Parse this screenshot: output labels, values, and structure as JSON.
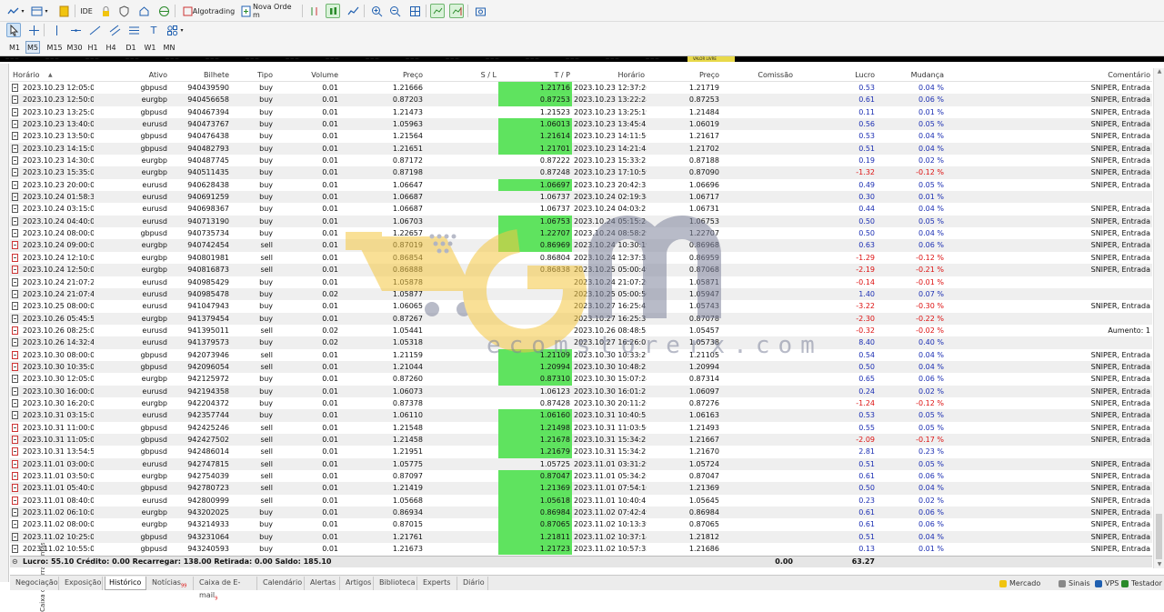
{
  "toolbar": {
    "algotrading_label": "Algotrading",
    "new_order_label": "Nova Orde m",
    "ide_label": "IDE"
  },
  "timeframes": [
    "M1",
    "M5",
    "M15",
    "M30",
    "H1",
    "H4",
    "D1",
    "W1",
    "MN"
  ],
  "active_timeframe": "M5",
  "columns": {
    "time": "Horário",
    "symbol": "Ativo",
    "ticket": "Bilhete",
    "type": "Tipo",
    "volume": "Volume",
    "price": "Preço",
    "sl": "S / L",
    "tp": "T / P",
    "close_time": "Horário",
    "close_price": "Preço",
    "commission": "Comissão",
    "profit": "Lucro",
    "change": "Mudança",
    "comment": "Comentário"
  },
  "rows": [
    {
      "t": "2023.10.23 12:05:03",
      "s": "gbpusd",
      "b": "940439590",
      "ty": "buy",
      "v": "0.01",
      "p": "1.21666",
      "tp": "1.21716",
      "ct": "2023.10.23 12:37:20",
      "cp": "1.21719",
      "pr": "0.53",
      "ch": "0.04 %",
      "cm": "SNIPER, Entrada"
    },
    {
      "t": "2023.10.23 12:50:02",
      "s": "eurgbp",
      "b": "940456658",
      "ty": "buy",
      "v": "0.01",
      "p": "0.87203",
      "tp": "0.87253",
      "ct": "2023.10.23 13:22:28",
      "cp": "0.87253",
      "pr": "0.61",
      "ch": "0.06 %",
      "cm": "SNIPER, Entrada"
    },
    {
      "t": "2023.10.23 13:25:02",
      "s": "gbpusd",
      "b": "940467394",
      "ty": "buy",
      "v": "0.01",
      "p": "1.21473",
      "tp": "1.21523",
      "ct": "2023.10.23 13:25:19",
      "cp": "1.21484",
      "pr": "0.11",
      "ch": "0.01 %",
      "cm": "SNIPER, Entrada"
    },
    {
      "t": "2023.10.23 13:40:03",
      "s": "eurusd",
      "b": "940473767",
      "ty": "buy",
      "v": "0.01",
      "p": "1.05963",
      "tp": "1.06013",
      "ct": "2023.10.23 13:45:43",
      "cp": "1.06019",
      "pr": "0.56",
      "ch": "0.05 %",
      "cm": "SNIPER, Entrada"
    },
    {
      "t": "2023.10.23 13:50:04",
      "s": "gbpusd",
      "b": "940476438",
      "ty": "buy",
      "v": "0.01",
      "p": "1.21564",
      "tp": "1.21614",
      "ct": "2023.10.23 14:11:56",
      "cp": "1.21617",
      "pr": "0.53",
      "ch": "0.04 %",
      "cm": "SNIPER, Entrada"
    },
    {
      "t": "2023.10.23 14:15:02",
      "s": "gbpusd",
      "b": "940482793",
      "ty": "buy",
      "v": "0.01",
      "p": "1.21651",
      "tp": "1.21701",
      "ct": "2023.10.23 14:21:48",
      "cp": "1.21702",
      "pr": "0.51",
      "ch": "0.04 %",
      "cm": "SNIPER, Entrada"
    },
    {
      "t": "2023.10.23 14:30:03",
      "s": "eurgbp",
      "b": "940487745",
      "ty": "buy",
      "v": "0.01",
      "p": "0.87172",
      "tp": "0.87222",
      "ct": "2023.10.23 15:33:23",
      "cp": "0.87188",
      "pr": "0.19",
      "ch": "0.02 %",
      "cm": "SNIPER, Entrada"
    },
    {
      "t": "2023.10.23 15:35:02",
      "s": "eurgbp",
      "b": "940511435",
      "ty": "buy",
      "v": "0.01",
      "p": "0.87198",
      "tp": "0.87248",
      "ct": "2023.10.23 17:10:59",
      "cp": "0.87090",
      "pr": "-1.32",
      "ch": "-0.12 %",
      "cm": "SNIPER, Entrada"
    },
    {
      "t": "2023.10.23 20:00:02",
      "s": "eurusd",
      "b": "940628438",
      "ty": "buy",
      "v": "0.01",
      "p": "1.06647",
      "tp": "1.06697",
      "ct": "2023.10.23 20:42:33",
      "cp": "1.06696",
      "pr": "0.49",
      "ch": "0.05 %",
      "cm": "SNIPER, Entrada"
    },
    {
      "t": "2023.10.24 01:58:36",
      "s": "eurusd",
      "b": "940691259",
      "ty": "buy",
      "v": "0.01",
      "p": "1.06687",
      "tp": "1.06737",
      "ct": "2023.10.24 02:19:34",
      "cp": "1.06717",
      "pr": "0.30",
      "ch": "0.01 %",
      "cm": ""
    },
    {
      "t": "2023.10.24 03:15:02",
      "s": "eurusd",
      "b": "940698367",
      "ty": "buy",
      "v": "0.01",
      "p": "1.06687",
      "tp": "1.06737",
      "ct": "2023.10.24 04:03:21",
      "cp": "1.06731",
      "pr": "0.44",
      "ch": "0.04 %",
      "cm": "SNIPER, Entrada"
    },
    {
      "t": "2023.10.24 04:40:03",
      "s": "eurusd",
      "b": "940713190",
      "ty": "buy",
      "v": "0.01",
      "p": "1.06703",
      "tp": "1.06753",
      "ct": "2023.10.24 05:15:28",
      "cp": "1.06753",
      "pr": "0.50",
      "ch": "0.05 %",
      "cm": "SNIPER, Entrada"
    },
    {
      "t": "2023.10.24 08:00:03",
      "s": "gbpusd",
      "b": "940735734",
      "ty": "buy",
      "v": "0.01",
      "p": "1.22657",
      "tp": "1.22707",
      "ct": "2023.10.24 08:58:29",
      "cp": "1.22707",
      "pr": "0.50",
      "ch": "0.04 %",
      "cm": "SNIPER, Entrada"
    },
    {
      "t": "2023.10.24 09:00:02",
      "s": "eurgbp",
      "b": "940742454",
      "ty": "sell",
      "v": "0.01",
      "p": "0.87019",
      "tp": "0.86969",
      "ct": "2023.10.24 10:30:19",
      "cp": "0.86968",
      "pr": "0.63",
      "ch": "0.06 %",
      "cm": "SNIPER, Entrada"
    },
    {
      "t": "2023.10.24 12:10:02",
      "s": "eurgbp",
      "b": "940801981",
      "ty": "sell",
      "v": "0.01",
      "p": "0.86854",
      "tp": "0.86804",
      "ct": "2023.10.24 12:37:35",
      "cp": "0.86959",
      "pr": "-1.29",
      "ch": "-0.12 %",
      "cm": "SNIPER, Entrada"
    },
    {
      "t": "2023.10.24 12:50:02",
      "s": "eurgbp",
      "b": "940816873",
      "ty": "sell",
      "v": "0.01",
      "p": "0.86888",
      "tp": "0.86838",
      "ct": "2023.10.25 05:00:49",
      "cp": "0.87068",
      "pr": "-2.19",
      "ch": "-0.21 %",
      "cm": "SNIPER, Entrada"
    },
    {
      "t": "2023.10.24 21:07:20",
      "s": "eurusd",
      "b": "940985429",
      "ty": "buy",
      "v": "0.01",
      "p": "1.05878",
      "tp": "",
      "ct": "2023.10.24 21:07:26",
      "cp": "1.05871",
      "pr": "-0.14",
      "ch": "-0.01 %",
      "cm": ""
    },
    {
      "t": "2023.10.24 21:07:41",
      "s": "eurusd",
      "b": "940985478",
      "ty": "buy",
      "v": "0.02",
      "p": "1.05877",
      "tp": "",
      "ct": "2023.10.25 05:00:50",
      "cp": "1.05947",
      "pr": "1.40",
      "ch": "0.07 %",
      "cm": ""
    },
    {
      "t": "2023.10.25 08:00:02",
      "s": "eurusd",
      "b": "941047943",
      "ty": "buy",
      "v": "0.01",
      "p": "1.06065",
      "tp": "",
      "ct": "2023.10.27 16:25:42",
      "cp": "1.05743",
      "pr": "-3.22",
      "ch": "-0.30 %",
      "cm": "SNIPER, Entrada"
    },
    {
      "t": "2023.10.26 05:45:57",
      "s": "eurgbp",
      "b": "941379454",
      "ty": "buy",
      "v": "0.01",
      "p": "0.87267",
      "tp": "",
      "ct": "2023.10.27 16:25:37",
      "cp": "0.87078",
      "pr": "-2.30",
      "ch": "-0.22 %",
      "cm": ""
    },
    {
      "t": "2023.10.26 08:25:04",
      "s": "eurusd",
      "b": "941395011",
      "ty": "sell",
      "v": "0.02",
      "p": "1.05441",
      "tp": "",
      "ct": "2023.10.26 08:48:55",
      "cp": "1.05457",
      "pr": "-0.32",
      "ch": "-0.02 %",
      "cm": "Aumento: 1"
    },
    {
      "t": "2023.10.26 14:32:43",
      "s": "eurusd",
      "b": "941379573",
      "ty": "buy",
      "v": "0.02",
      "p": "1.05318",
      "tp": "",
      "ct": "2023.10.27 16:26:02",
      "cp": "1.05738",
      "pr": "8.40",
      "ch": "0.40 %",
      "cm": ""
    },
    {
      "t": "2023.10.30 08:00:03",
      "s": "gbpusd",
      "b": "942073946",
      "ty": "sell",
      "v": "0.01",
      "p": "1.21159",
      "tp": "1.21109",
      "ct": "2023.10.30 10:33:29",
      "cp": "1.21105",
      "pr": "0.54",
      "ch": "0.04 %",
      "cm": "SNIPER, Entrada"
    },
    {
      "t": "2023.10.30 10:35:02",
      "s": "gbpusd",
      "b": "942096054",
      "ty": "sell",
      "v": "0.01",
      "p": "1.21044",
      "tp": "1.20994",
      "ct": "2023.10.30 10:48:23",
      "cp": "1.20994",
      "pr": "0.50",
      "ch": "0.04 %",
      "cm": "SNIPER, Entrada"
    },
    {
      "t": "2023.10.30 12:05:02",
      "s": "eurgbp",
      "b": "942125972",
      "ty": "buy",
      "v": "0.01",
      "p": "0.87260",
      "tp": "0.87310",
      "ct": "2023.10.30 15:07:24",
      "cp": "0.87314",
      "pr": "0.65",
      "ch": "0.06 %",
      "cm": "SNIPER, Entrada"
    },
    {
      "t": "2023.10.30 16:00:02",
      "s": "eurusd",
      "b": "942194358",
      "ty": "buy",
      "v": "0.01",
      "p": "1.06073",
      "tp": "1.06123",
      "ct": "2023.10.30 16:01:21",
      "cp": "1.06097",
      "pr": "0.24",
      "ch": "0.02 %",
      "cm": "SNIPER, Entrada"
    },
    {
      "t": "2023.10.30 16:20:02",
      "s": "eurgbp",
      "b": "942204372",
      "ty": "buy",
      "v": "0.01",
      "p": "0.87378",
      "tp": "0.87428",
      "ct": "2023.10.30 20:11:26",
      "cp": "0.87276",
      "pr": "-1.24",
      "ch": "-0.12 %",
      "cm": "SNIPER, Entrada"
    },
    {
      "t": "2023.10.31 03:15:02",
      "s": "eurusd",
      "b": "942357744",
      "ty": "buy",
      "v": "0.01",
      "p": "1.06110",
      "tp": "1.06160",
      "ct": "2023.10.31 10:40:55",
      "cp": "1.06163",
      "pr": "0.53",
      "ch": "0.05 %",
      "cm": "SNIPER, Entrada"
    },
    {
      "t": "2023.10.31 11:00:03",
      "s": "gbpusd",
      "b": "942425246",
      "ty": "sell",
      "v": "0.01",
      "p": "1.21548",
      "tp": "1.21498",
      "ct": "2023.10.31 11:03:50",
      "cp": "1.21493",
      "pr": "0.55",
      "ch": "0.05 %",
      "cm": "SNIPER, Entrada"
    },
    {
      "t": "2023.10.31 11:05:03",
      "s": "gbpusd",
      "b": "942427502",
      "ty": "sell",
      "v": "0.01",
      "p": "1.21458",
      "tp": "1.21678",
      "ct": "2023.10.31 15:34:21",
      "cp": "1.21667",
      "pr": "-2.09",
      "ch": "-0.17 %",
      "cm": "SNIPER, Entrada"
    },
    {
      "t": "2023.10.31 13:54:53",
      "s": "gbpusd",
      "b": "942486014",
      "ty": "sell",
      "v": "0.01",
      "p": "1.21951",
      "tp": "1.21679",
      "ct": "2023.10.31 15:34:21",
      "cp": "1.21670",
      "pr": "2.81",
      "ch": "0.23 %",
      "cm": ""
    },
    {
      "t": "2023.11.01 03:00:02",
      "s": "eurusd",
      "b": "942747815",
      "ty": "sell",
      "v": "0.01",
      "p": "1.05775",
      "tp": "1.05725",
      "ct": "2023.11.01 03:31:29",
      "cp": "1.05724",
      "pr": "0.51",
      "ch": "0.05 %",
      "cm": "SNIPER, Entrada"
    },
    {
      "t": "2023.11.01 03:50:02",
      "s": "eurgbp",
      "b": "942754039",
      "ty": "sell",
      "v": "0.01",
      "p": "0.87097",
      "tp": "0.87047",
      "ct": "2023.11.01 05:34:26",
      "cp": "0.87047",
      "pr": "0.61",
      "ch": "0.06 %",
      "cm": "SNIPER, Entrada"
    },
    {
      "t": "2023.11.01 05:40:03",
      "s": "gbpusd",
      "b": "942780723",
      "ty": "sell",
      "v": "0.01",
      "p": "1.21419",
      "tp": "1.21369",
      "ct": "2023.11.01 07:54:10",
      "cp": "1.21369",
      "pr": "0.50",
      "ch": "0.04 %",
      "cm": "SNIPER, Entrada"
    },
    {
      "t": "2023.11.01 08:40:02",
      "s": "eurusd",
      "b": "942800999",
      "ty": "sell",
      "v": "0.01",
      "p": "1.05668",
      "tp": "1.05618",
      "ct": "2023.11.01 10:40:47",
      "cp": "1.05645",
      "pr": "0.23",
      "ch": "0.02 %",
      "cm": "SNIPER, Entrada"
    },
    {
      "t": "2023.11.02 06:10:03",
      "s": "eurgbp",
      "b": "943202025",
      "ty": "buy",
      "v": "0.01",
      "p": "0.86934",
      "tp": "0.86984",
      "ct": "2023.11.02 07:42:49",
      "cp": "0.86984",
      "pr": "0.61",
      "ch": "0.06 %",
      "cm": "SNIPER, Entrada"
    },
    {
      "t": "2023.11.02 08:00:02",
      "s": "eurgbp",
      "b": "943214933",
      "ty": "buy",
      "v": "0.01",
      "p": "0.87015",
      "tp": "0.87065",
      "ct": "2023.11.02 10:13:39",
      "cp": "0.87065",
      "pr": "0.61",
      "ch": "0.06 %",
      "cm": "SNIPER, Entrada"
    },
    {
      "t": "2023.11.02 10:25:02",
      "s": "gbpusd",
      "b": "943231064",
      "ty": "buy",
      "v": "0.01",
      "p": "1.21761",
      "tp": "1.21811",
      "ct": "2023.11.02 10:37:14",
      "cp": "1.21812",
      "pr": "0.51",
      "ch": "0.04 %",
      "cm": "SNIPER, Entrada"
    },
    {
      "t": "2023.11.02 10:55:02",
      "s": "gbpusd",
      "b": "943240593",
      "ty": "buy",
      "v": "0.01",
      "p": "1.21673",
      "tp": "1.21723",
      "ct": "2023.11.02 10:57:32",
      "cp": "1.21686",
      "pr": "0.13",
      "ch": "0.01 %",
      "cm": "SNIPER, Entrada"
    }
  ],
  "tp_hit_rows": [
    0,
    1,
    3,
    4,
    5,
    8,
    11,
    12,
    13,
    22,
    23,
    24,
    27,
    28,
    29,
    30,
    32,
    33,
    34,
    35,
    36,
    37,
    38
  ],
  "summary": {
    "text": "Lucro: 55.10  Crédito: 0.00  Recarregar: 138.00  Retirada: 0.00  Saldo: 185.10",
    "commission": "0.00",
    "profit": "63.27"
  },
  "side_panel_label": "Caixa de Ferramentas",
  "tabs": [
    "Negociação",
    "Exposição",
    "Histórico",
    "Notícias",
    "Caixa de E-mail",
    "Calendário",
    "Alertas",
    "Artigos",
    "Biblioteca",
    "Experts",
    "Diário"
  ],
  "active_tab": "Histórico",
  "news_badge": "99",
  "mail_badge": "9",
  "status": {
    "market": "Mercado",
    "signals": "Sinais",
    "vps": "VPS",
    "tester": "Testador"
  },
  "watermark": {
    "domain": "ecomstorerx.com"
  },
  "ticker_highlight": "VALOR LIVRE",
  "colors": {
    "tp_hit": "#5fe35f",
    "negative": "#d11111",
    "positive": "#1c2fb3",
    "watermark_yellow": "#f5c842",
    "watermark_gray": "#7f849c"
  }
}
